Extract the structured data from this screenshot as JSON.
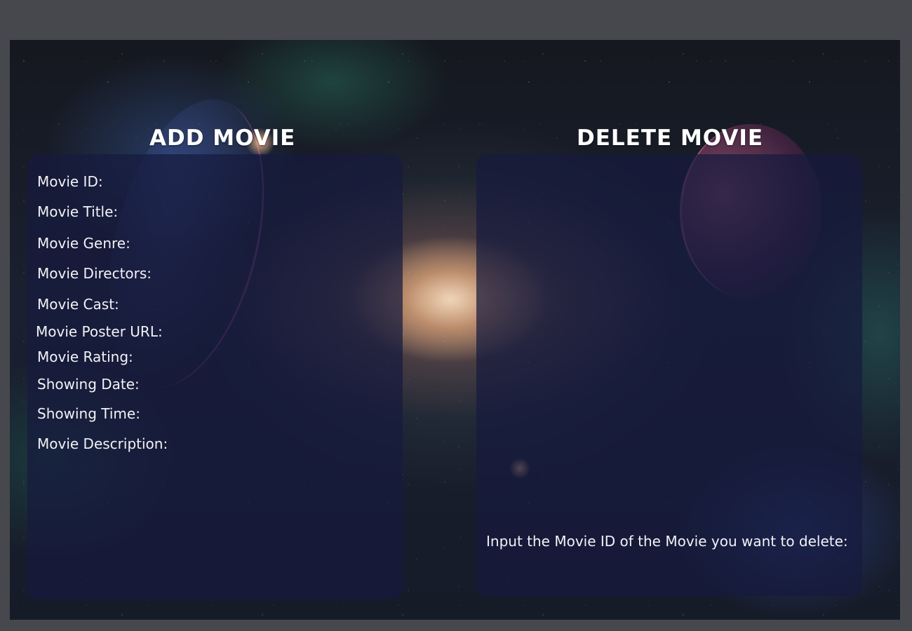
{
  "add_movie": {
    "title": "ADD MOVIE",
    "fields": [
      {
        "label": "Movie ID:"
      },
      {
        "label": "Movie Title:"
      },
      {
        "label": "Movie Genre:"
      },
      {
        "label": "Movie Directors:"
      },
      {
        "label": "Movie Cast:"
      },
      {
        "label": "Movie Poster URL:"
      },
      {
        "label": "Movie Rating:"
      },
      {
        "label": "Showing Date:"
      },
      {
        "label": "Showing Time:"
      },
      {
        "label": "Movie Description:"
      }
    ]
  },
  "delete_movie": {
    "title": "DELETE MOVIE",
    "instruction": "Input the Movie ID of the Movie you want to delete:"
  },
  "colors": {
    "page_background": "#47484d",
    "panel_background": "#161b3e",
    "text": "#ffffff"
  }
}
